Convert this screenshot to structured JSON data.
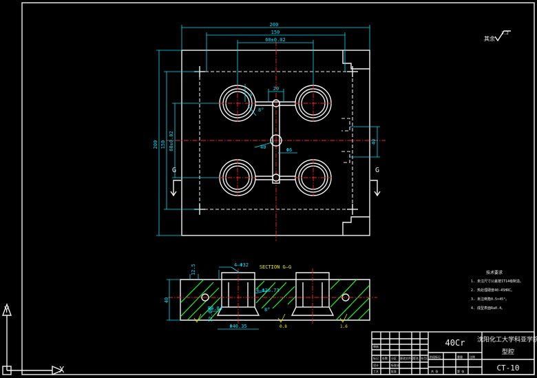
{
  "drawing": {
    "dims": {
      "overall_width": "200",
      "inner_width": "150",
      "cavity_pitch": "60±0.02",
      "overall_height": "200",
      "inner_height": "150",
      "cavity_pitch_v": "60±0.02",
      "runner_width": "20",
      "angle_top": "8°",
      "sprue_dia": "Φ6",
      "dim_40": "40",
      "dim_6": "6",
      "side_40": "40"
    },
    "section_marker": "G",
    "roughness": {
      "label": "其余",
      "value": "3.2"
    },
    "section": {
      "title": "SECTION G—G",
      "callout_1": "4—Φ32",
      "callout_2": "4—Φ26.73",
      "callout_3": "R4.84",
      "callout_4": "Φ40.35",
      "callout_5": "8°",
      "callout_6": "0.8",
      "callout_7": "1.6",
      "side_1": "12.5",
      "side_2": "12.06",
      "height": "40"
    },
    "notes": {
      "heading": "技术要求",
      "lines": [
        "1. 未注尺寸公差按IT14级制造。",
        "2. 热处理硬度40-45HRC。",
        "3. 未注倒角0.5×45°。",
        "4. 成型表面Ra0.4。"
      ]
    },
    "title_block": {
      "material": "40Cr",
      "school": "沈阳化工大学科亚学院",
      "part_name": "型腔",
      "drawing_no": "CT-10",
      "row_labels": [
        "标记",
        "处数",
        "分区",
        "更改文件号",
        "签名",
        "年月日"
      ],
      "row_labels_2": [
        "设计",
        "",
        "标准化",
        "",
        "阶段标记",
        "重量",
        "比例"
      ],
      "row_labels_3": [
        "审核",
        "",
        "",
        "",
        "",
        "",
        ""
      ],
      "row_labels_4": [
        "工艺",
        "",
        "批准",
        "",
        "共 张",
        "第 张"
      ]
    },
    "ucs": {
      "x_label": "X",
      "y_label": "Y"
    }
  }
}
